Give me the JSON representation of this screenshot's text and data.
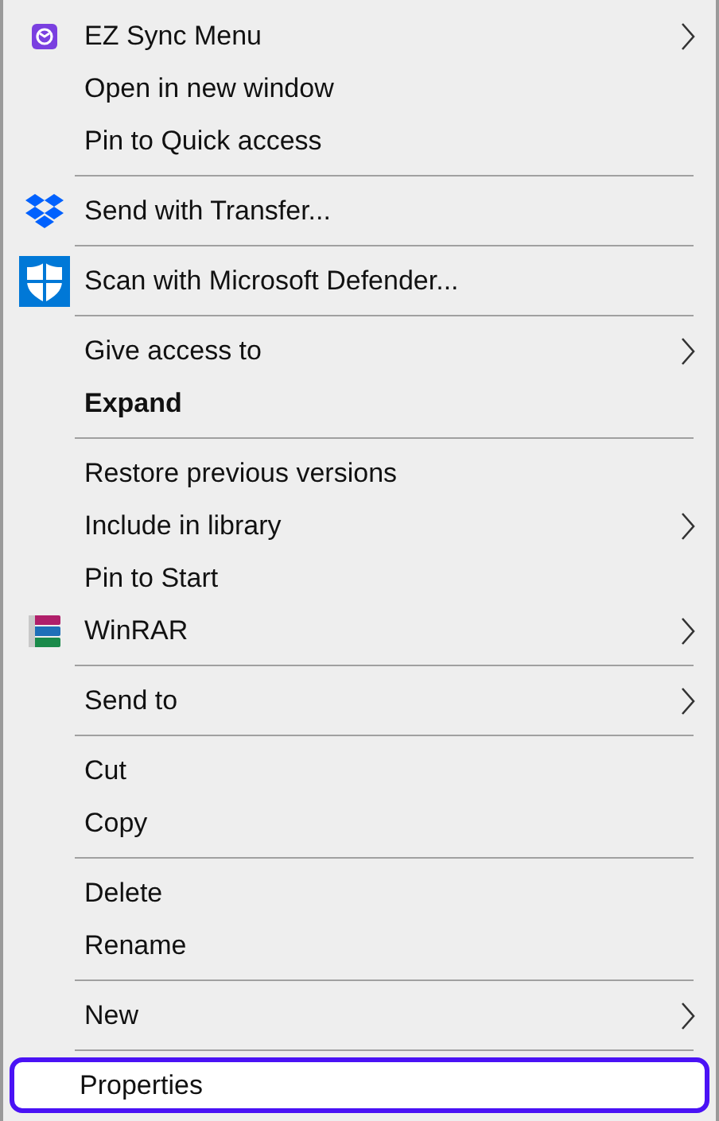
{
  "menu": {
    "groups": [
      {
        "items": [
          {
            "kind": "sync",
            "label": "EZ Sync Menu",
            "submenu": true,
            "bold": false,
            "selected": false
          },
          {
            "kind": "plain",
            "label": "Open in new window",
            "submenu": false,
            "bold": false,
            "selected": false
          },
          {
            "kind": "plain",
            "label": "Pin to Quick access",
            "submenu": false,
            "bold": false,
            "selected": false
          }
        ]
      },
      {
        "items": [
          {
            "kind": "dropbox",
            "label": "Send with Transfer...",
            "submenu": false,
            "bold": false,
            "selected": false
          }
        ]
      },
      {
        "items": [
          {
            "kind": "shield",
            "label": "Scan with Microsoft Defender...",
            "submenu": false,
            "bold": false,
            "selected": false
          }
        ]
      },
      {
        "items": [
          {
            "kind": "plain",
            "label": "Give access to",
            "submenu": true,
            "bold": false,
            "selected": false
          },
          {
            "kind": "plain",
            "label": "Expand",
            "submenu": false,
            "bold": true,
            "selected": false
          }
        ]
      },
      {
        "items": [
          {
            "kind": "plain",
            "label": "Restore previous versions",
            "submenu": false,
            "bold": false,
            "selected": false
          },
          {
            "kind": "plain",
            "label": "Include in library",
            "submenu": true,
            "bold": false,
            "selected": false
          },
          {
            "kind": "plain",
            "label": "Pin to Start",
            "submenu": false,
            "bold": false,
            "selected": false
          },
          {
            "kind": "archive",
            "label": "WinRAR",
            "submenu": true,
            "bold": false,
            "selected": false
          }
        ]
      },
      {
        "items": [
          {
            "kind": "plain",
            "label": "Send to",
            "submenu": true,
            "bold": false,
            "selected": false
          }
        ]
      },
      {
        "items": [
          {
            "kind": "plain",
            "label": "Cut",
            "submenu": false,
            "bold": false,
            "selected": false
          },
          {
            "kind": "plain",
            "label": "Copy",
            "submenu": false,
            "bold": false,
            "selected": false
          }
        ]
      },
      {
        "items": [
          {
            "kind": "plain",
            "label": "Delete",
            "submenu": false,
            "bold": false,
            "selected": false
          },
          {
            "kind": "plain",
            "label": "Rename",
            "submenu": false,
            "bold": false,
            "selected": false
          }
        ]
      },
      {
        "items": [
          {
            "kind": "plain",
            "label": "New",
            "submenu": true,
            "bold": false,
            "selected": false
          }
        ]
      },
      {
        "items": [
          {
            "kind": "plain",
            "label": "Properties",
            "submenu": false,
            "bold": false,
            "selected": true
          }
        ]
      }
    ]
  }
}
